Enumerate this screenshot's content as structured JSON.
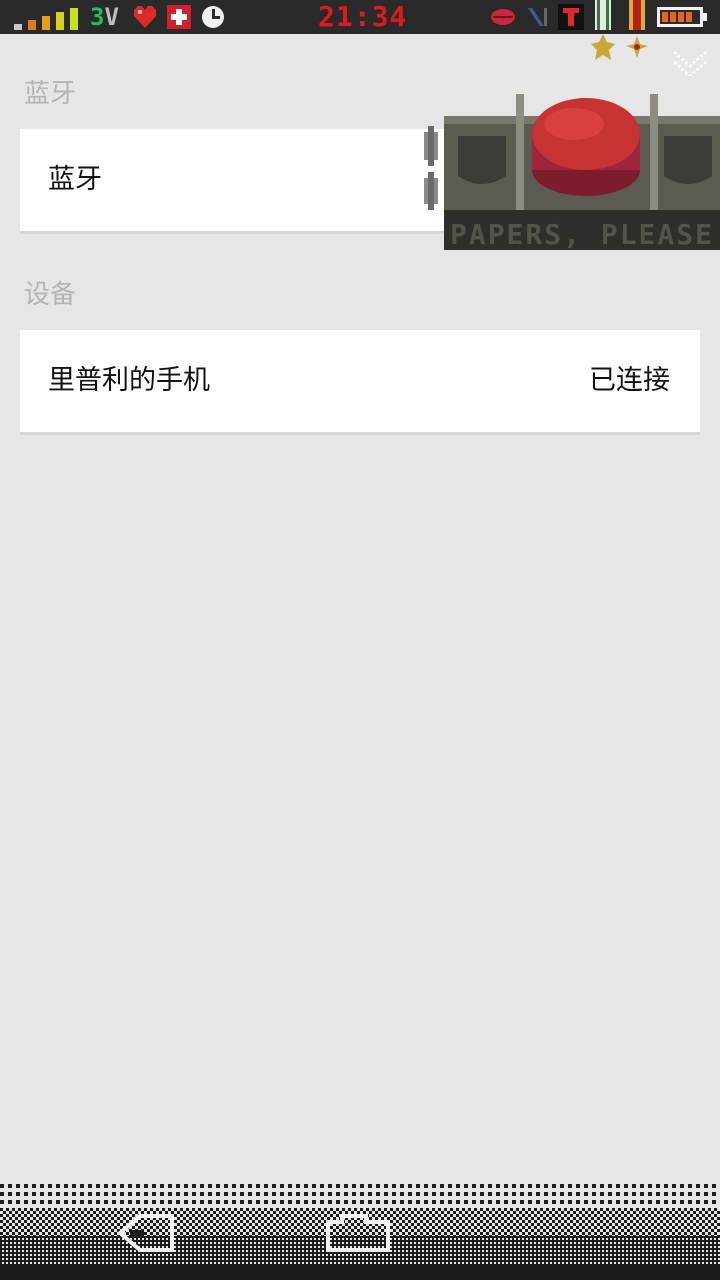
{
  "status_bar": {
    "network_number": "3",
    "network_letter": "V",
    "time": "21:34",
    "icons": [
      "signal-bars-icon",
      "heart-icon",
      "medical-cross-icon",
      "clock-icon",
      "lips-icon",
      "diagonal-mark-icon",
      "t-tile-icon",
      "medal-green-icon",
      "medal-red-icon",
      "battery-icon"
    ],
    "colors": {
      "clock": "#e01a1a",
      "network": "#1fc25a",
      "bar": "#2a2a2a"
    }
  },
  "sections": [
    {
      "header": "蓝牙",
      "item_label": "蓝牙"
    },
    {
      "header": "设备",
      "item_label": "里普利的手机",
      "item_value": "已连接"
    }
  ],
  "overlay_art": {
    "text": "PAPERS, PLEASE"
  },
  "nav": {
    "icons": [
      "back-icon",
      "home-icon"
    ]
  }
}
